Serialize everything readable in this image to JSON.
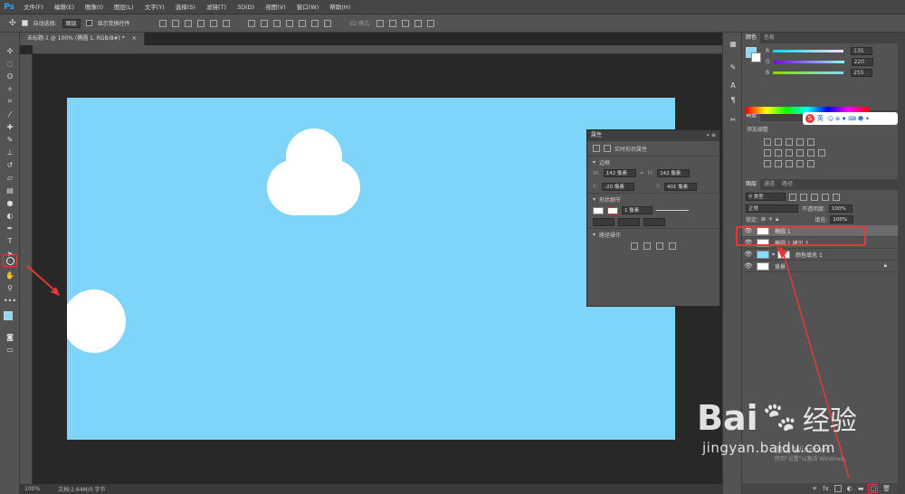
{
  "app": {
    "logo": "Ps"
  },
  "menu": [
    "文件(F)",
    "编辑(E)",
    "图像(I)",
    "图层(L)",
    "文字(Y)",
    "选择(S)",
    "滤镜(T)",
    "3D(D)",
    "视图(V)",
    "窗口(W)",
    "帮助(H)"
  ],
  "options_bar": {
    "auto_select_label": "自动选择:",
    "auto_select_value": "图层",
    "show_transform_label": "显示变换控件",
    "mode3d_label": "3D 模式:"
  },
  "document": {
    "tab_title": "未标题-1 @ 100% (椭圆 1, RGB/8#) *",
    "close": "×",
    "zoom": "100%",
    "doc_info": "文档:2.64M/0 字节"
  },
  "properties": {
    "title": "属性",
    "subtitle": "实时形状属性",
    "section_transform": "边框",
    "w_label": "W:",
    "w_value": "142 像素",
    "h_label": "H:",
    "h_value": "142 像素",
    "x_label": "X:",
    "x_value": "-20 像素",
    "y_label": "Y:",
    "y_value": "401 像素",
    "section_shape": "形状细节",
    "stroke_value": "1 像素",
    "section_path": "路径操作"
  },
  "color_panel": {
    "tabs": [
      "颜色",
      "色板"
    ],
    "r": {
      "label": "R",
      "value": "135"
    },
    "g": {
      "label": "G",
      "value": "220"
    },
    "b": {
      "label": "B",
      "value": "255"
    },
    "swatch": "#87dcff"
  },
  "adjust_panel": {
    "tab": "调整",
    "add_label": "添加调整"
  },
  "sogou": {
    "text": "英"
  },
  "layers_panel": {
    "tabs": [
      "图层",
      "通道",
      "路径"
    ],
    "filter": "类型",
    "blend": "正常",
    "opacity_label": "不透明度:",
    "opacity": "100%",
    "lock_label": "锁定:",
    "fill_label": "填充:",
    "fill": "100%",
    "layers": [
      {
        "name": "椭圆 1",
        "selected": true
      },
      {
        "name": "椭圆 1 拷贝 2",
        "selected": false
      },
      {
        "name": "颜色填充 1",
        "selected": false
      },
      {
        "name": "背景",
        "selected": false
      }
    ],
    "fx": "fx"
  },
  "watermark": {
    "brand": "Bai",
    "brand2": "经验",
    "url": "jingyan.baidu.com",
    "activate": "激活 Windows",
    "activate2": "转到\"设置\"以激活 Windows。"
  },
  "colors": {
    "doc_bg": "#7fd4fa",
    "highlight": "#e53935",
    "canvas_bg": "#282828",
    "panel": "#535353"
  }
}
